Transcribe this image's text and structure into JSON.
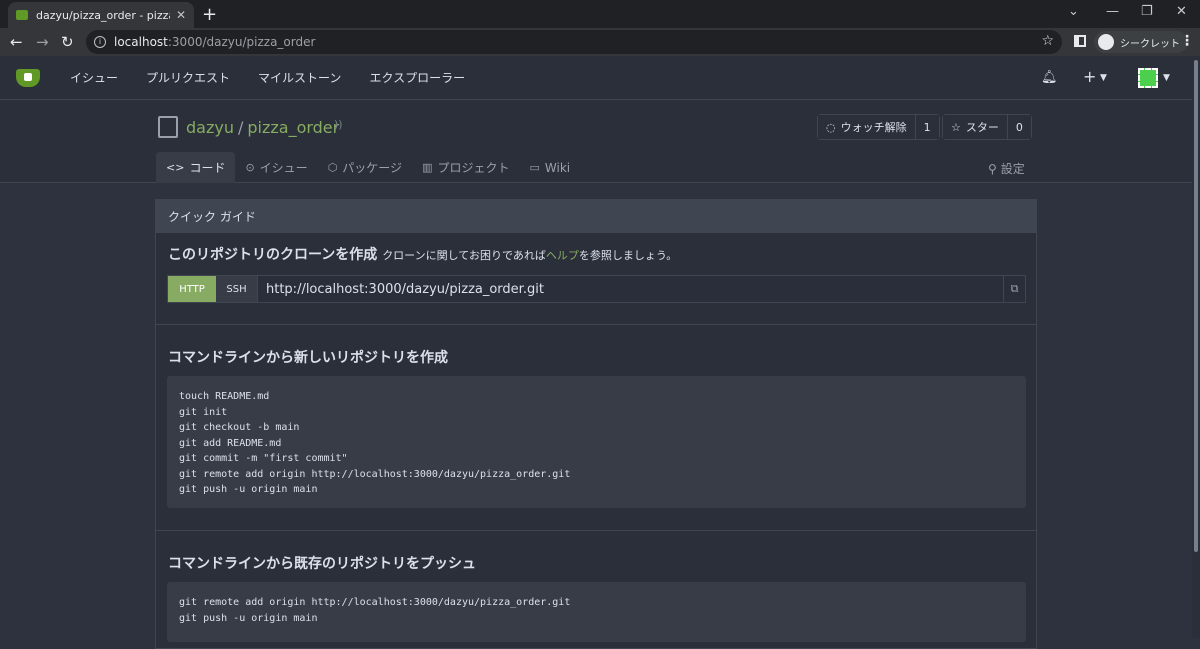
{
  "browser": {
    "tab_title": "dazyu/pizza_order - pizza_order",
    "close_glyph": "✕",
    "newtab_glyph": "+",
    "url_host": "localhost",
    "url_path": ":3000/dazyu/pizza_order",
    "profile_label": "シークレット"
  },
  "nav": {
    "items": [
      "イシュー",
      "プルリクエスト",
      "マイルストーン",
      "エクスプローラー"
    ],
    "plus": "+"
  },
  "repo": {
    "owner": "dazyu",
    "name": "pizza_order",
    "separator": "/",
    "watch_label": "ウォッチ解除",
    "watch_count": "1",
    "star_label": "スター",
    "star_count": "0",
    "tabs": [
      {
        "icon": "<>",
        "label": "コード"
      },
      {
        "icon": "⊙",
        "label": "イシュー"
      },
      {
        "icon": "⬡",
        "label": "パッケージ"
      },
      {
        "icon": "▥",
        "label": "プロジェクト"
      },
      {
        "icon": "▭",
        "label": "Wiki"
      }
    ],
    "settings_label": "設定"
  },
  "guide": {
    "header": "クイック ガイド",
    "clone_title": "このリポジトリのクローンを作成",
    "clone_sub_pre": "クローンに関してお困りであれば",
    "clone_help": "ヘルプ",
    "clone_sub_post": "を参照しましょう。",
    "http_label": "HTTP",
    "ssh_label": "SSH",
    "clone_url": "http://localhost:3000/dazyu/pizza_order.git",
    "new_title": "コマンドラインから新しいリポジトリを作成",
    "new_code": "touch README.md\ngit init\ngit checkout -b main\ngit add README.md\ngit commit -m \"first commit\"\ngit remote add origin http://localhost:3000/dazyu/pizza_order.git\ngit push -u origin main",
    "push_title": "コマンドラインから既存のリポジトリをプッシュ",
    "push_code": "git remote add origin http://localhost:3000/dazyu/pizza_order.git\ngit push -u origin main"
  }
}
